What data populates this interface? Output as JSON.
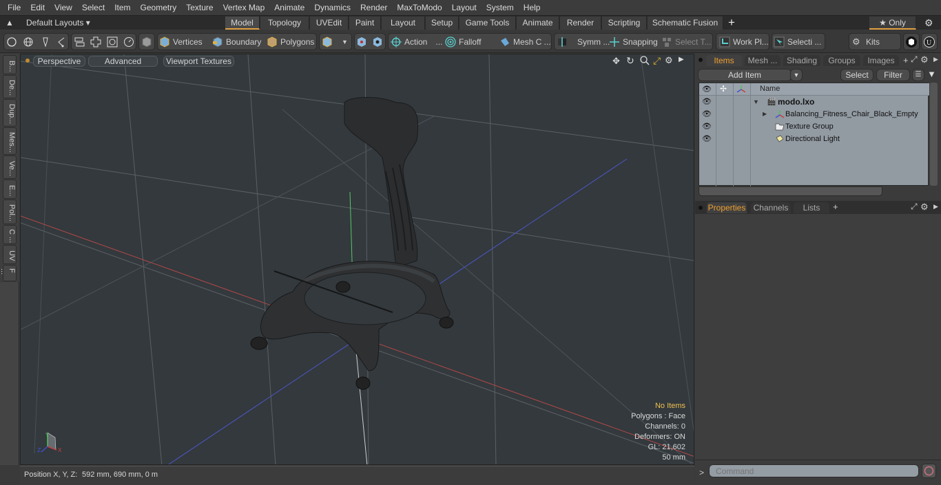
{
  "menu": [
    "File",
    "Edit",
    "View",
    "Select",
    "Item",
    "Geometry",
    "Texture",
    "Vertex Map",
    "Animate",
    "Dynamics",
    "Render",
    "MaxToModo",
    "Layout",
    "System",
    "Help"
  ],
  "layout_bar": {
    "layouts_label": "Default Layouts ▾",
    "tabs": [
      "Model",
      "Topology",
      "UVEdit",
      "Paint",
      "Layout",
      "Setup",
      "Game Tools",
      "Animate",
      "Render",
      "Scripting",
      "Schematic Fusion"
    ],
    "active_tab": "Model",
    "add_tab": "+",
    "only_label": "★ Only"
  },
  "toolbar": {
    "vertices": "Vertices",
    "boundary": "Boundary",
    "polygons": "Polygons",
    "action": "Action",
    "falloff": "Falloff",
    "mesh_c": "Mesh C ...",
    "symm": "Symm ...",
    "snapping": "Snapping",
    "select_t": "Select T...",
    "work_pl": "Work Pl...",
    "selecti": "Selecti ...",
    "kits": "Kits",
    "ellipsis": "..."
  },
  "left_tabs": [
    "B...",
    "De...",
    "Dup...",
    "Mes...",
    "Ve...",
    "E...",
    "Pol...",
    "C ...",
    "UV",
    "F ..."
  ],
  "viewport": {
    "buttons": [
      "Perspective",
      "Advanced",
      "Viewport Textures"
    ],
    "hud": {
      "selection": "No Items",
      "polygons": "Polygons : Face",
      "channels": "Channels: 0",
      "deformers": "Deformers: ON",
      "gl": "GL: 21,602",
      "scale": "50 mm"
    },
    "axis_labels": {
      "x": "X",
      "y": "Y",
      "z": "Z"
    }
  },
  "status": {
    "position_label": "Position X, Y, Z:",
    "position_value": "592 mm, 690 mm, 0 m"
  },
  "right_panel": {
    "top_tabs": [
      "Items",
      "Mesh ...",
      "Shading",
      "Groups",
      "Images"
    ],
    "active_top_tab": "Items",
    "add_item": "Add Item",
    "select": "Select",
    "filter": "Filter",
    "column_name": "Name",
    "items": [
      {
        "name": "modo.lxo",
        "bold": true,
        "icon": "scene-icon"
      },
      {
        "name": "Balancing_Fitness_Chair_Black_Empty",
        "bold": false,
        "icon": "locator-icon"
      },
      {
        "name": "Texture Group",
        "bold": false,
        "icon": "texture-group-icon"
      },
      {
        "name": "Directional Light",
        "bold": false,
        "icon": "light-icon"
      }
    ],
    "bottom_tabs": [
      "Properties",
      "Channels",
      "Lists"
    ],
    "active_bottom_tab": "Properties",
    "command_placeholder": "Command",
    "command_prompt": ">"
  },
  "colors": {
    "accent": "#e0a040",
    "hud_highlight": "#f0c050",
    "axis_x": "#c04040",
    "axis_y": "#50c060",
    "axis_z": "#4050c0"
  }
}
